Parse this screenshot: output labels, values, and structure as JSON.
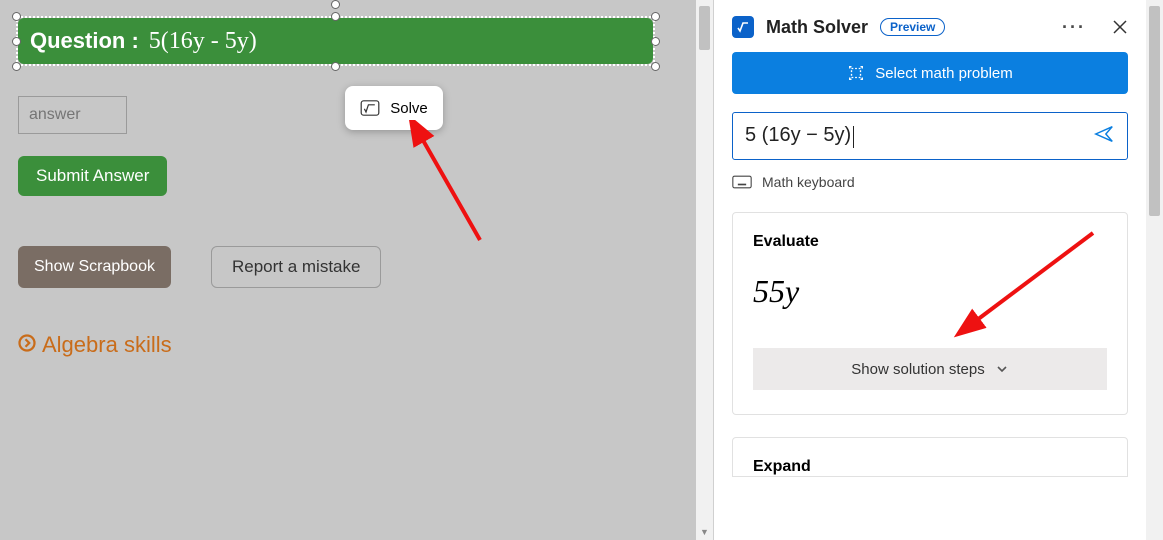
{
  "left": {
    "question_label": "Question  :",
    "question_expression": "5(16y - 5y)",
    "answer_placeholder": "answer",
    "submit_label": "Submit Answer",
    "scrapbook_label": "Show Scrapbook",
    "report_label": "Report a mistake",
    "algebra_link": "Algebra skills",
    "solve_popup_label": "Solve"
  },
  "solver": {
    "title": "Math Solver",
    "preview_badge": "Preview",
    "select_button": "Select math problem",
    "expression": "5 (16y − 5y)",
    "keyboard_label": "Math keyboard",
    "evaluate_title": "Evaluate",
    "evaluate_result": "55y",
    "show_steps_label": "Show solution steps",
    "expand_title": "Expand"
  }
}
